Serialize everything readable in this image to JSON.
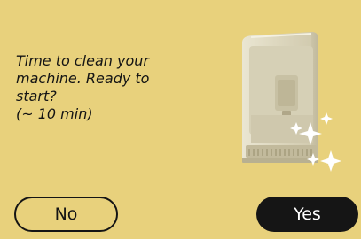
{
  "prompt": {
    "lines": [
      "Time to clean your",
      "machine. Ready to",
      "start?",
      "(~ 10 min)"
    ]
  },
  "illustration": {
    "icon": "coffee-machine-cleaning-sparkles-icon"
  },
  "buttons": {
    "no_label": "No",
    "yes_label": "Yes"
  },
  "colors": {
    "background": "#e8d17c",
    "text": "#141414",
    "yes_button_bg": "#151515",
    "yes_button_text": "#ffffff",
    "machine_body": "#ddd8c0"
  }
}
